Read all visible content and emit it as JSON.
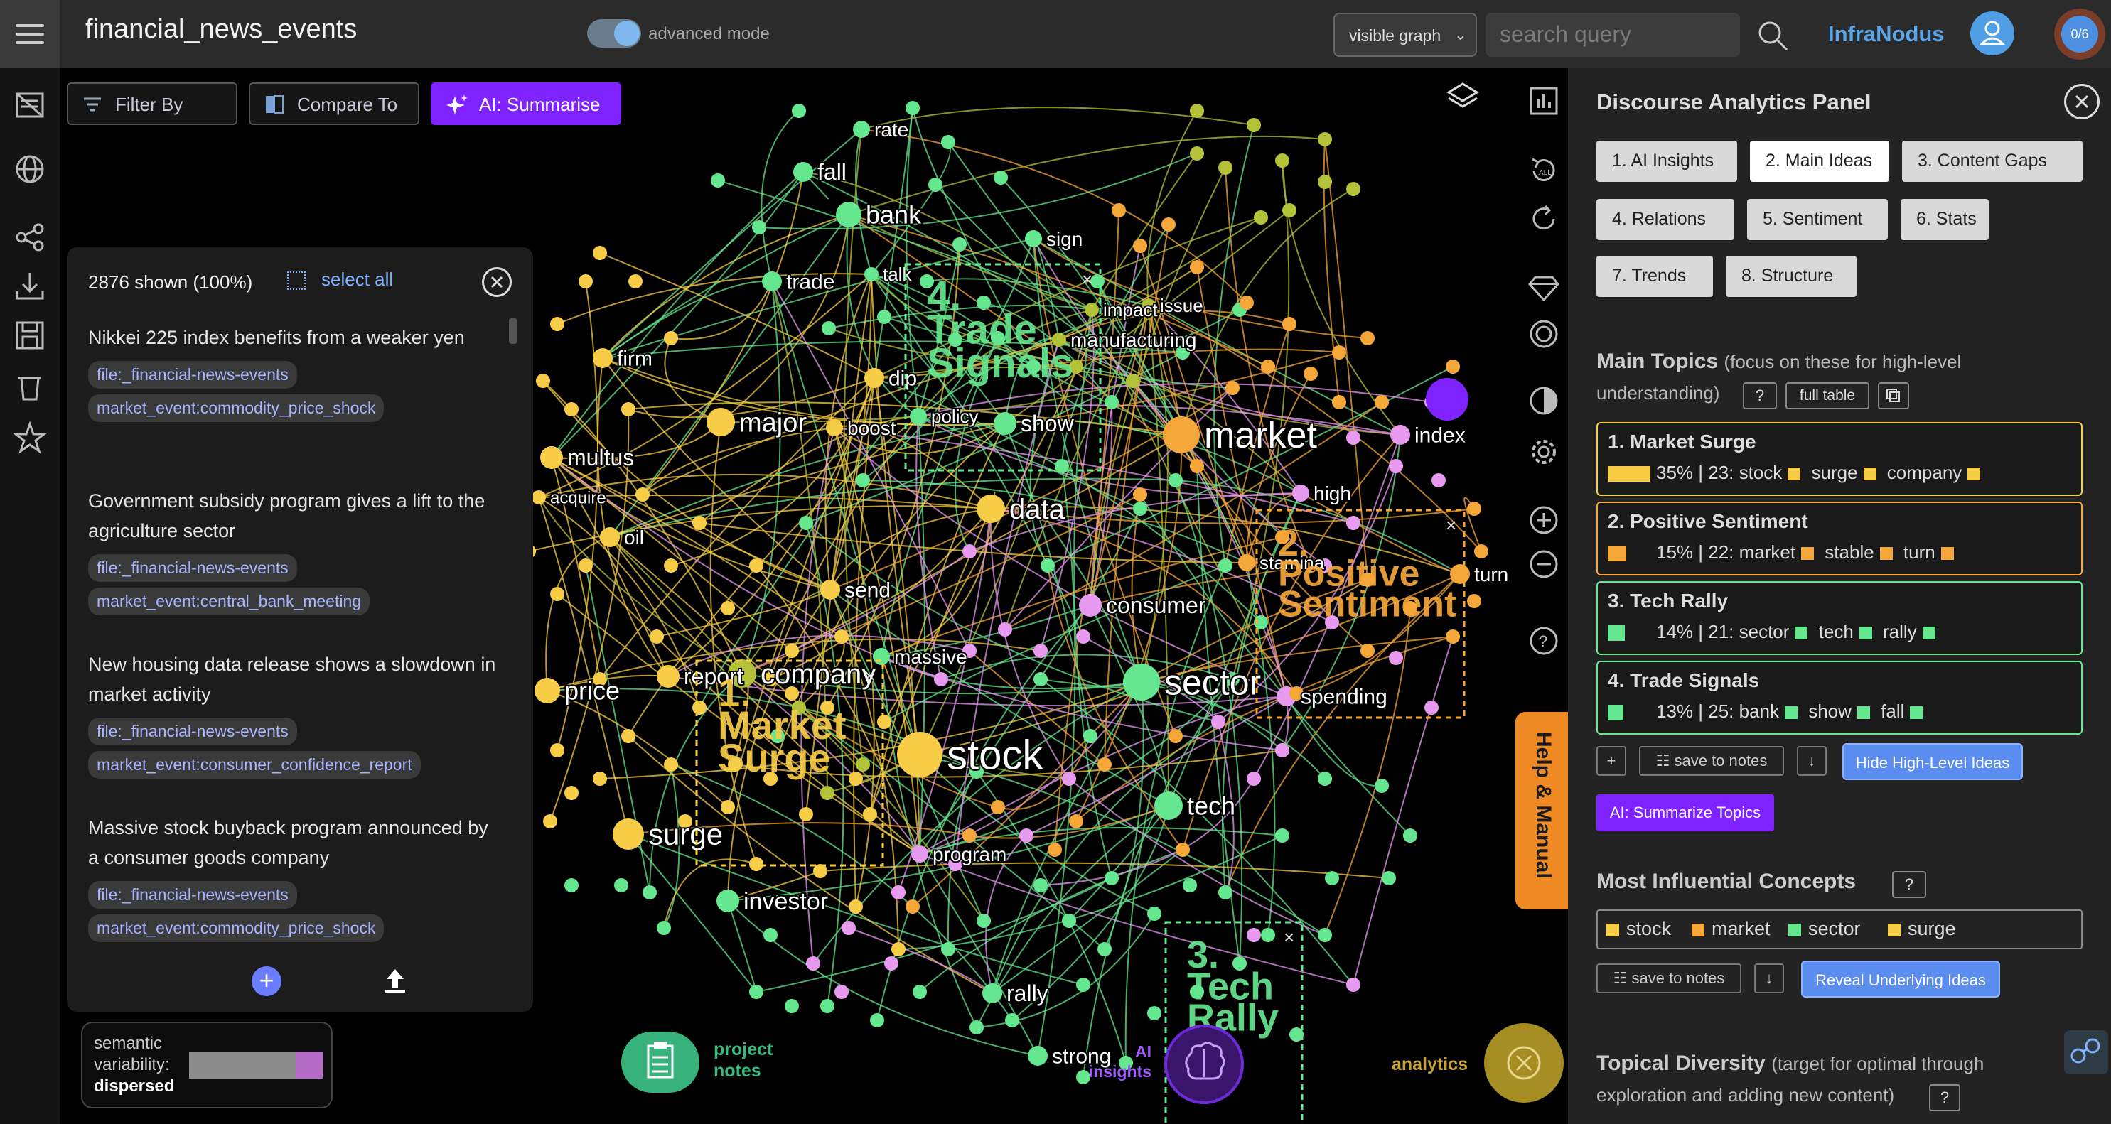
{
  "app": {
    "title": "financial_news_events",
    "advanced_label": "advanced mode",
    "brand": "InfraNodus",
    "counter": "0/6"
  },
  "header": {
    "graph_select": "visible graph",
    "search_placeholder": "search query"
  },
  "toolbar": {
    "filter": "Filter By",
    "compare": "Compare To",
    "summarise": "AI: Summarise"
  },
  "statements": {
    "count": "2876 shown (100%)",
    "select_all": "select all",
    "items": [
      {
        "text": "Nikkei 225 index benefits from a weaker yen",
        "tags": [
          "file:_financial-news-events",
          "market_event:commodity_price_shock"
        ]
      },
      {
        "text": "Government subsidy program gives a lift to the agriculture sector",
        "tags": [
          "file:_financial-news-events",
          "market_event:central_bank_meeting"
        ]
      },
      {
        "text": "New housing data release shows a slowdown in market activity",
        "tags": [
          "file:_financial-news-events",
          "market_event:consumer_confidence_report"
        ]
      },
      {
        "text": "Massive stock buyback program announced by a consumer goods company",
        "tags": [
          "file:_financial-news-events",
          "market_event:commodity_price_shock"
        ]
      }
    ]
  },
  "semantic": {
    "label1": "semantic",
    "label2": "variability:",
    "value": "dispersed",
    "level_pct": 80
  },
  "bottom": {
    "project_notes": [
      "project",
      "notes"
    ],
    "ai_insights": [
      "AI",
      "insights"
    ],
    "analytics": "analytics",
    "help": "Help & Manual"
  },
  "colors": {
    "yellow": "#f7cd47",
    "green": "#65e78f",
    "orange": "#f5a73a",
    "pink": "#e79af0",
    "olive": "#b4c23a",
    "purple": "#7e22ff"
  },
  "graph": {
    "labels": [
      "rate",
      "fall",
      "bank",
      "sign",
      "trade",
      "talk",
      "issue",
      "impact",
      "manufacturing",
      "firm",
      "dip",
      "major",
      "boost",
      "policy",
      "show",
      "market",
      "index",
      "multus",
      "acquire",
      "high",
      "data",
      "oil",
      "send",
      "consumer",
      "stamina",
      "turn",
      "massive",
      "report",
      "price",
      "company",
      "sector",
      "spending",
      "stock",
      "surge",
      "tech",
      "program",
      "investor",
      "rally",
      "strong"
    ],
    "clusters": [
      {
        "id": "1.",
        "name": "Market Surge"
      },
      {
        "id": "2.",
        "name": "Positive Sentiment"
      },
      {
        "id": "3.",
        "name": "Tech Rally"
      },
      {
        "id": "4.",
        "name": "Trade Signals"
      }
    ]
  },
  "panel": {
    "title": "Discourse Analytics Panel",
    "tabs": [
      "1. AI Insights",
      "2. Main Ideas",
      "3. Content Gaps",
      "4. Relations",
      "5. Sentiment",
      "6. Stats",
      "7. Trends",
      "8. Structure"
    ],
    "main_topics": {
      "title": "Main Topics",
      "hint": "(focus on these for high-level",
      "hint2": "understanding)",
      "q": "?",
      "full_table": "full table",
      "topics": [
        {
          "title": "1. Market Surge",
          "pct": "35% | 23:",
          "words": [
            "stock",
            "surge",
            "company"
          ],
          "color": "#f7cd47",
          "share": 35
        },
        {
          "title": "2. Positive Sentiment",
          "pct": "15% | 22:",
          "words": [
            "market",
            "stable",
            "turn"
          ],
          "color": "#f5a73a",
          "share": 15
        },
        {
          "title": "3. Tech Rally",
          "pct": "14% | 21:",
          "words": [
            "sector",
            "tech",
            "rally"
          ],
          "color": "#65e78f",
          "share": 14
        },
        {
          "title": "4. Trade Signals",
          "pct": "13% | 25:",
          "words": [
            "bank",
            "show",
            "fall"
          ],
          "color": "#65e78f",
          "share": 13
        }
      ],
      "plus": "+",
      "save_notes": "save to notes",
      "down": "↓",
      "hide_btn": "Hide High-Level Ideas",
      "ai_summarize": "AI: Summarize Topics"
    },
    "influential": {
      "title": "Most Influential Concepts",
      "q": "?",
      "concepts": [
        {
          "word": "stock",
          "color": "#f7cd47"
        },
        {
          "word": "market",
          "color": "#f5a73a"
        },
        {
          "word": "sector",
          "color": "#65e78f"
        },
        {
          "word": "surge",
          "color": "#f7cd47"
        }
      ],
      "save_notes": "save to notes",
      "down": "↓",
      "reveal_btn": "Reveal Underlying Ideas"
    },
    "diversity": {
      "title": "Topical Diversity",
      "hint": "(target for optimal through",
      "hint2": "exploration and adding new content)",
      "q": "?"
    }
  }
}
